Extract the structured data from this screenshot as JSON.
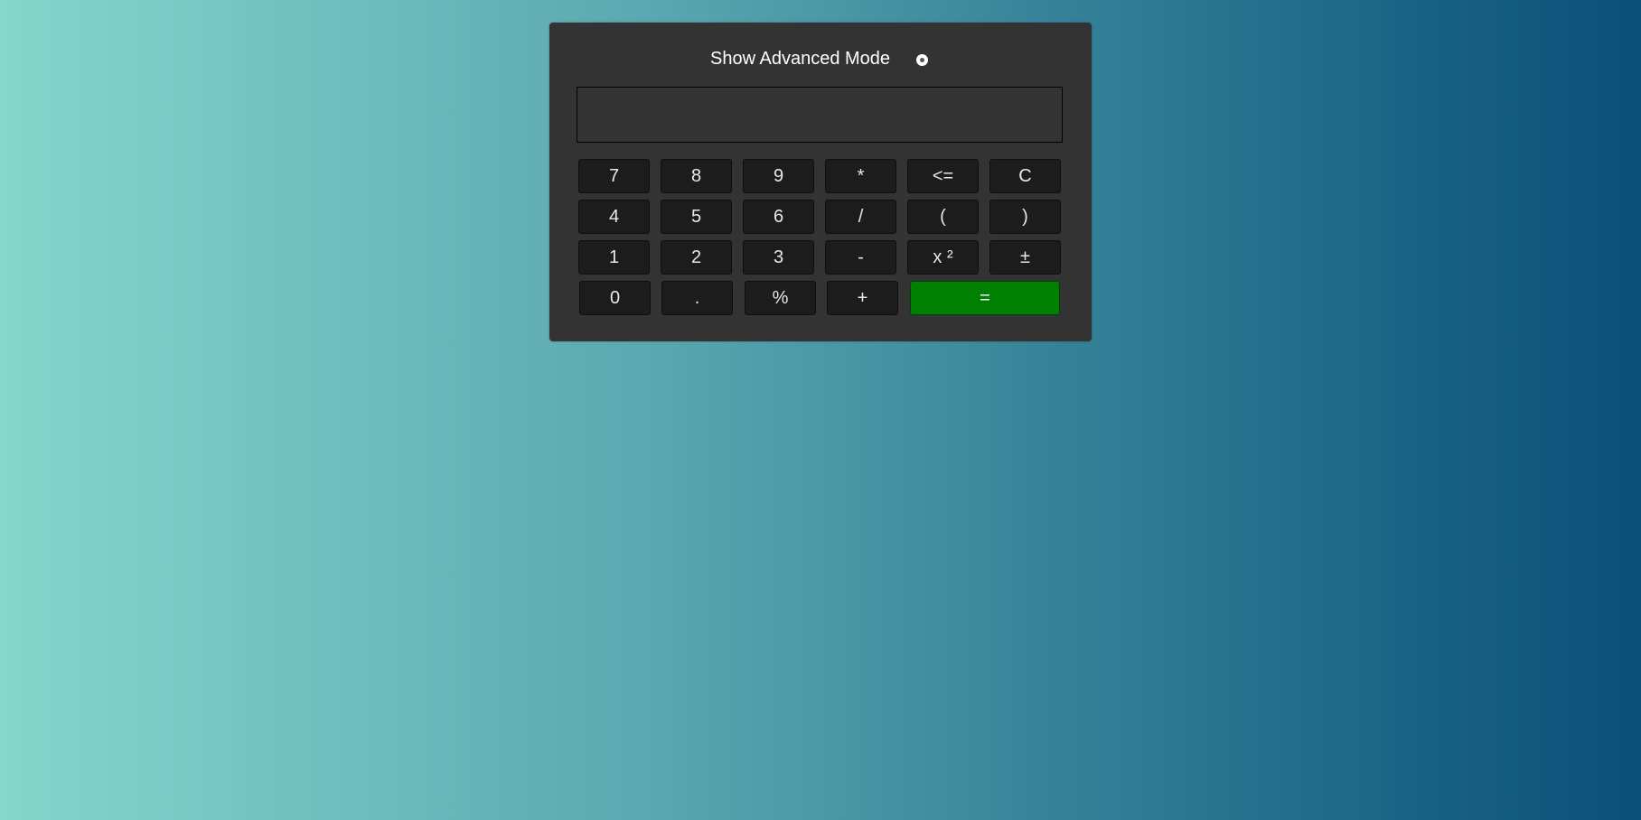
{
  "calculator": {
    "mode_label": "Show Advanced Mode",
    "display_value": "",
    "keys": {
      "k7": "7",
      "k8": "8",
      "k9": "9",
      "mul": "*",
      "back": "<=",
      "clear": "C",
      "k4": "4",
      "k5": "5",
      "k6": "6",
      "div": "/",
      "lparen": "(",
      "rparen": ")",
      "k1": "1",
      "k2": "2",
      "k3": "3",
      "sub": "-",
      "square": "x ²",
      "negate": "±",
      "k0": "0",
      "dot": ".",
      "percent": "%",
      "add": "+",
      "equals": "="
    }
  },
  "colors": {
    "panel": "#333333",
    "key": "#1c1c1c",
    "equals": "#008000"
  }
}
